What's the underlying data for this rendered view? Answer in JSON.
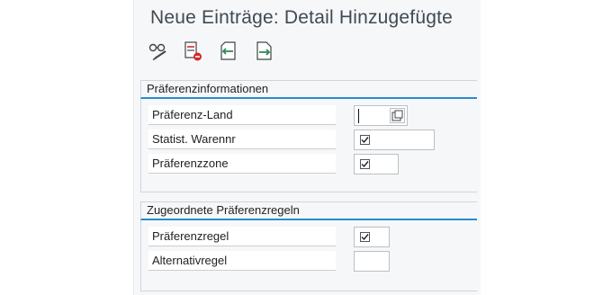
{
  "header": {
    "title": "Neue Einträge: Detail Hinzugefügte"
  },
  "toolbar": {
    "buttons": [
      {
        "icon": "glasses-edit-icon"
      },
      {
        "icon": "delete-entry-icon"
      },
      {
        "icon": "previous-entry-icon"
      },
      {
        "icon": "next-entry-icon"
      }
    ]
  },
  "groups": {
    "preference_info": {
      "title": "Präferenzinformationen",
      "fields": {
        "country": {
          "label": "Präferenz-Land",
          "value": ""
        },
        "stat_goods_no": {
          "label": "Statist. Warennr",
          "checked": true
        },
        "zone": {
          "label": "Präferenzzone",
          "checked": true
        }
      }
    },
    "assigned_rules": {
      "title": "Zugeordnete Präferenzregeln",
      "fields": {
        "rule": {
          "label": "Präferenzregel",
          "checked": true
        },
        "alt_rule": {
          "label": "Alternativregel",
          "value": ""
        }
      }
    }
  },
  "colors": {
    "accent": "#2a8ad2",
    "red": "#d42a2a",
    "green": "#2e8b57"
  }
}
